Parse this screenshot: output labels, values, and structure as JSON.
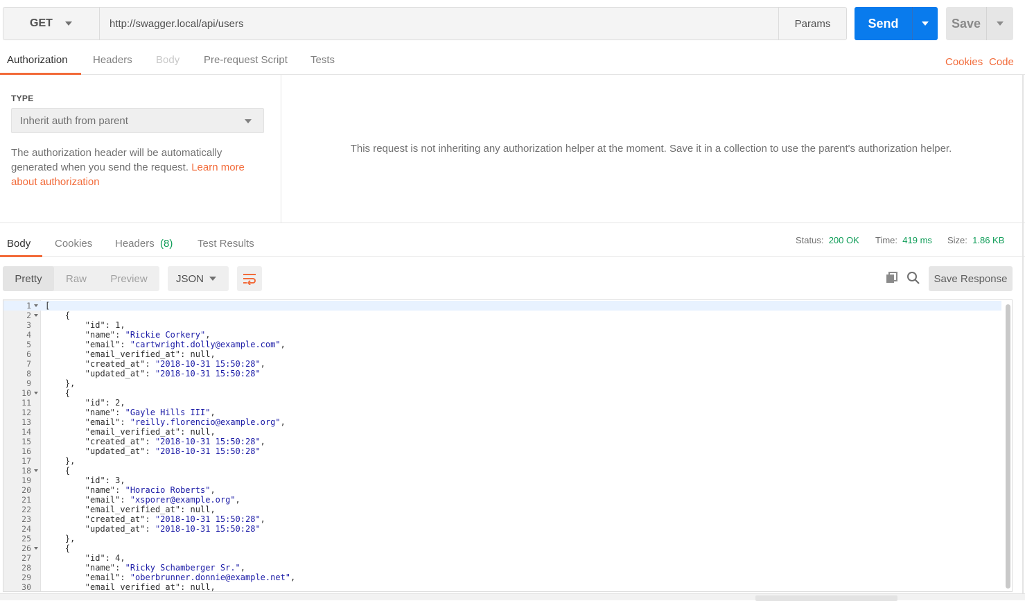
{
  "request": {
    "method": "GET",
    "url": "http://swagger.local/api/users",
    "params_label": "Params",
    "send_label": "Send",
    "save_label": "Save"
  },
  "request_tabs": {
    "authorization": "Authorization",
    "headers": "Headers",
    "body": "Body",
    "pre_request": "Pre-request Script",
    "tests": "Tests",
    "cookies": "Cookies",
    "code": "Code"
  },
  "auth": {
    "type_label": "TYPE",
    "type_value": "Inherit auth from parent",
    "desc": "The authorization header will be automatically generated when you send the request. ",
    "learn_more": "Learn more about authorization",
    "message": "This request is not inheriting any authorization helper at the moment. Save it in a collection to use the parent's authorization helper."
  },
  "response_tabs": {
    "body": "Body",
    "cookies": "Cookies",
    "headers": "Headers",
    "headers_count": "(8)",
    "test_results": "Test Results"
  },
  "response_meta": {
    "status_label": "Status:",
    "status_value": "200 OK",
    "time_label": "Time:",
    "time_value": "419 ms",
    "size_label": "Size:",
    "size_value": "1.86 KB"
  },
  "toolbar": {
    "pretty": "Pretty",
    "raw": "Raw",
    "preview": "Preview",
    "format": "JSON",
    "save_response": "Save Response"
  },
  "users": [
    {
      "id": "1",
      "name": "Rickie Corkery",
      "email": "cartwright.dolly@example.com",
      "created_at": "2018-10-31 15:50:28",
      "updated_at": "2018-10-31 15:50:28"
    },
    {
      "id": "2",
      "name": "Gayle Hills III",
      "email": "reilly.florencio@example.org",
      "created_at": "2018-10-31 15:50:28",
      "updated_at": "2018-10-31 15:50:28"
    },
    {
      "id": "3",
      "name": "Horacio Roberts",
      "email": "xsporer@example.org",
      "created_at": "2018-10-31 15:50:28",
      "updated_at": "2018-10-31 15:50:28"
    },
    {
      "id": "4",
      "name": "Ricky Schamberger Sr.",
      "email": "oberbrunner.donnie@example.net"
    }
  ],
  "colors": {
    "accent": "#f26b3a",
    "send": "#097bed",
    "success": "#0f9d58",
    "string": "#1a1aa6"
  }
}
